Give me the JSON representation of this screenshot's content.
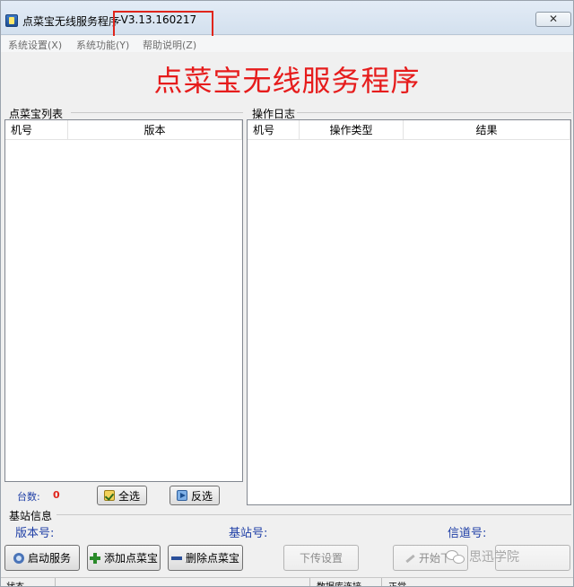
{
  "window": {
    "title": "点菜宝无线服务程序",
    "version": "-V3.13.160217",
    "close_symbol": "✕"
  },
  "menu": {
    "items": [
      "系统设置(X)",
      "系统功能(Y)",
      "帮助说明(Z)"
    ]
  },
  "banner": {
    "heading": "点菜宝无线服务程序"
  },
  "device_list": {
    "label": "点菜宝列表",
    "columns": [
      "机号",
      "版本"
    ],
    "rows": [],
    "count_label": "台数:",
    "count_value": "0",
    "select_all_label": "全选",
    "invert_label": "反选"
  },
  "operation_log": {
    "label": "操作日志",
    "columns": [
      "机号",
      "操作类型",
      "结果"
    ],
    "rows": []
  },
  "base_station": {
    "label": "基站信息",
    "version_label": "版本号:",
    "station_label": "基站号:",
    "channel_label": "信道号:"
  },
  "toolbar": {
    "start_service": "启动服务",
    "add_device": "添加点菜宝",
    "delete_device": "删除点菜宝",
    "upload_settings": "下传设置",
    "start_upload": "开始下"
  },
  "watermark": {
    "text": "思迅学院"
  },
  "statusbar": {
    "status_label": "状态",
    "db_label": "数据库连接",
    "db_value": "正常"
  }
}
